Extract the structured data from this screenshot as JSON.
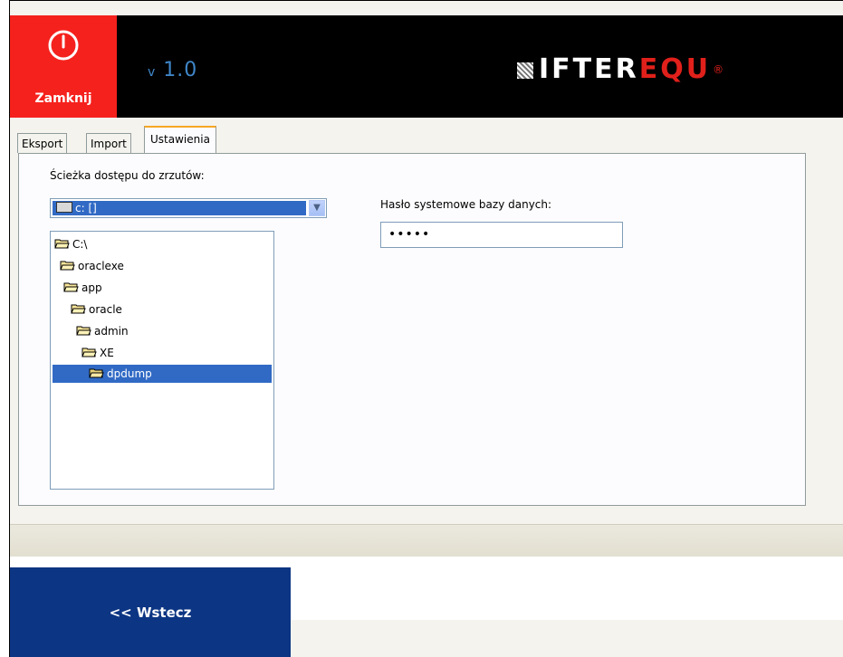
{
  "header": {
    "close_label": "Zamknij",
    "version": "1.0",
    "version_prefix": "v",
    "logo_white": "IFTER",
    "logo_red": "EQU",
    "logo_mark": "®"
  },
  "tabs": [
    {
      "label": "Eksport",
      "active": false
    },
    {
      "label": "Import",
      "active": false
    },
    {
      "label": "Ustawienia",
      "active": true
    }
  ],
  "settings": {
    "path_label": "Ścieżka dostępu do zrzutów:",
    "drive_value": "c: []",
    "password_label": "Hasło systemowe bazy danych:",
    "password_value": "•••••"
  },
  "tree": [
    {
      "label": "C:\\",
      "level": 0
    },
    {
      "label": "oraclexe",
      "level": 1
    },
    {
      "label": "app",
      "level": 2
    },
    {
      "label": "oracle",
      "level": 3
    },
    {
      "label": "admin",
      "level": 4
    },
    {
      "label": "XE",
      "level": 5
    },
    {
      "label": "dpdump",
      "level": 6,
      "selected": true
    }
  ],
  "footer": {
    "back_label": "<< Wstecz"
  },
  "colors": {
    "close_red": "#f5211d",
    "back_blue": "#0c3583",
    "selection": "#316ac5",
    "tab_accent": "#f5a623",
    "version_blue": "#3f86c8"
  }
}
